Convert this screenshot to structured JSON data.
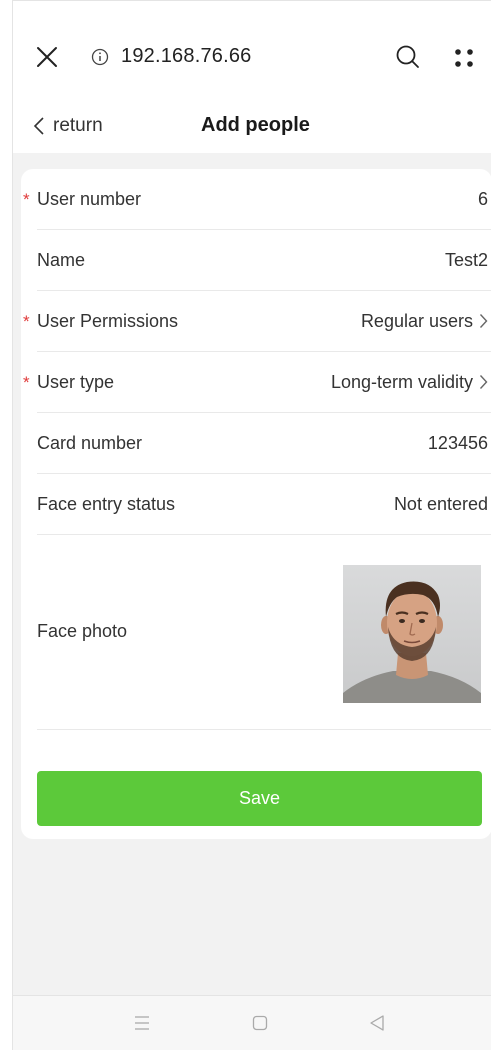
{
  "browser": {
    "url": "192.168.76.66",
    "icons": [
      "close-icon",
      "info-icon",
      "search-icon",
      "more-icon"
    ]
  },
  "header": {
    "back_label": "return",
    "title": "Add people"
  },
  "form": {
    "required_mark": "*",
    "rows": [
      {
        "label": "User number",
        "value": "6",
        "required": true,
        "chevron": false
      },
      {
        "label": "Name",
        "value": "Test2",
        "required": false,
        "chevron": false
      },
      {
        "label": "User Permissions",
        "value": "Regular users",
        "required": true,
        "chevron": true
      },
      {
        "label": "User type",
        "value": "Long-term validity",
        "required": true,
        "chevron": true
      },
      {
        "label": "Card number",
        "value": "123456",
        "required": false,
        "chevron": false
      },
      {
        "label": "Face entry status",
        "value": "Not entered",
        "required": false,
        "chevron": false
      }
    ],
    "photo_label": "Face photo",
    "save_label": "Save"
  },
  "colors": {
    "accent": "#5cc93a",
    "required": "#e03a3a",
    "background": "#f2f2f2"
  },
  "system_nav": {
    "icons": [
      "menu-icon",
      "home-icon",
      "back-triangle-icon"
    ]
  }
}
